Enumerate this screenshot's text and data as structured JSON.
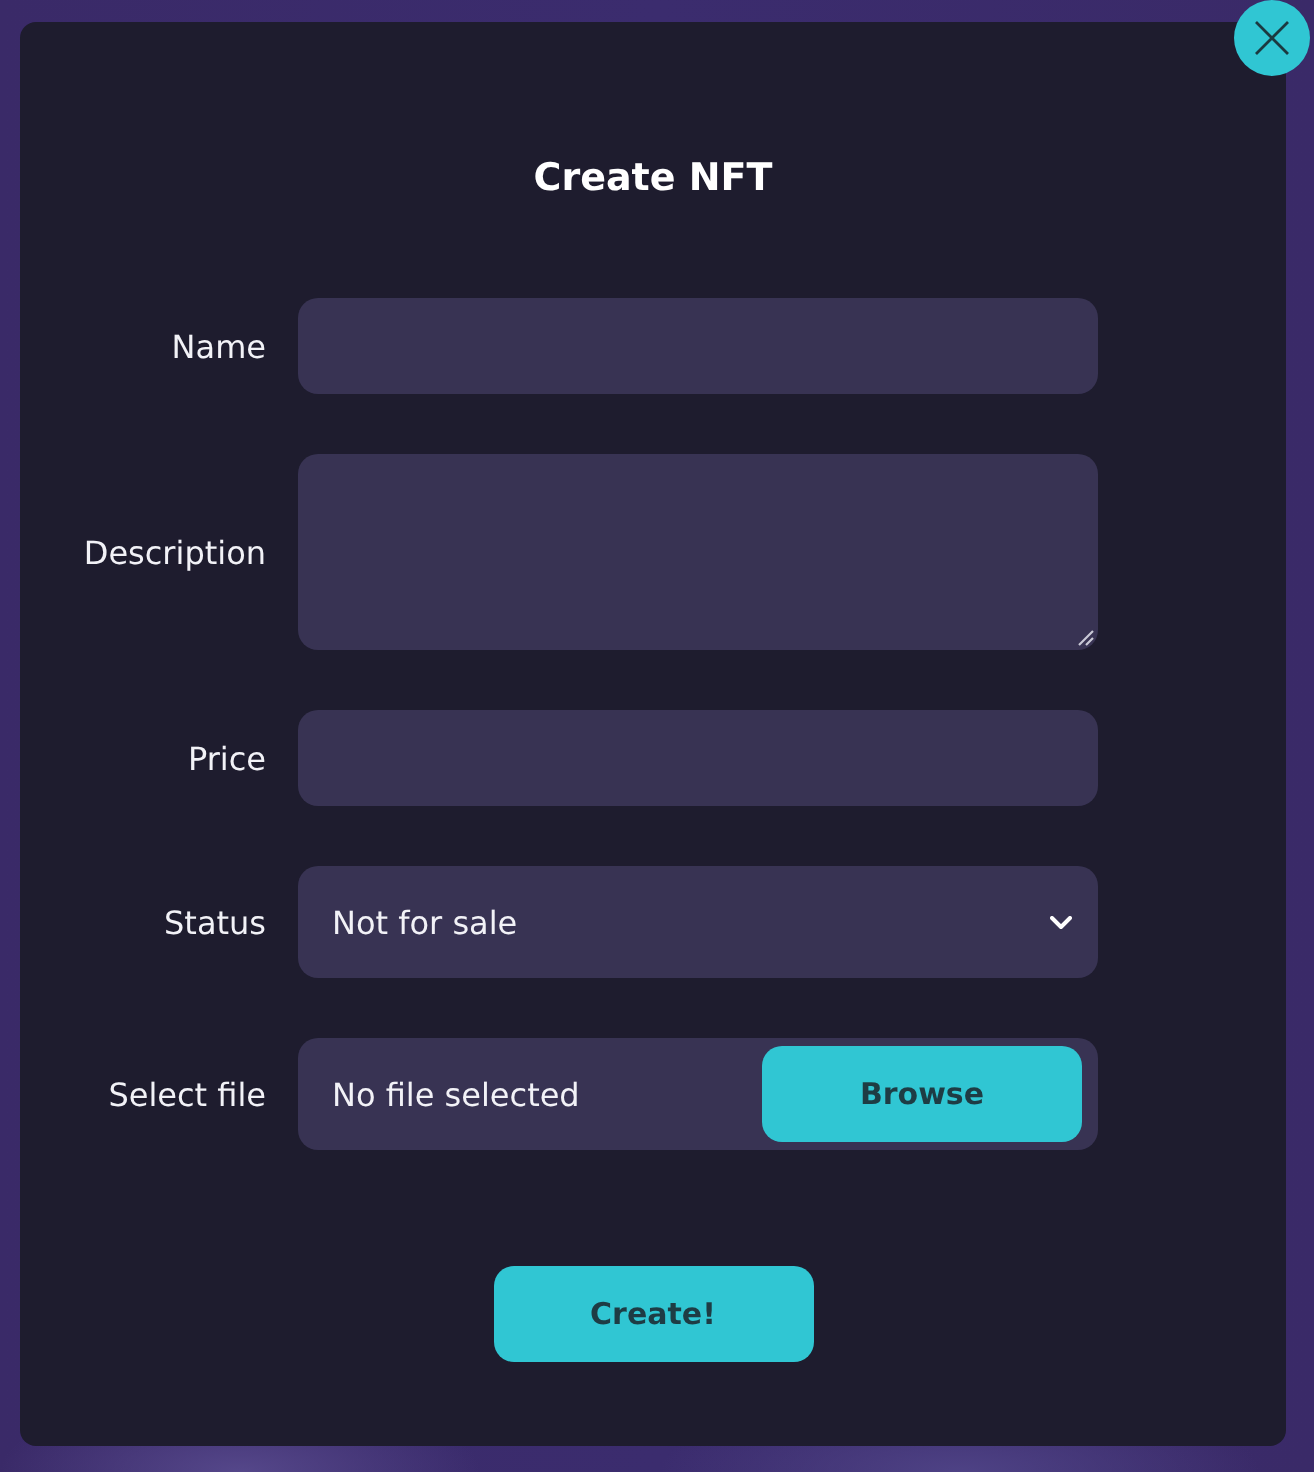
{
  "dialog": {
    "title": "Create NFT"
  },
  "fields": [
    {
      "kind": "text",
      "label": "Name"
    },
    {
      "kind": "textarea",
      "label": "Description"
    },
    {
      "kind": "text",
      "label": "Price"
    },
    {
      "kind": "select",
      "label": "Status",
      "value": "Not for sale"
    },
    {
      "kind": "file",
      "label": "Select file",
      "value": "No file selected",
      "button": "Browse"
    }
  ],
  "submit": "Create!"
}
